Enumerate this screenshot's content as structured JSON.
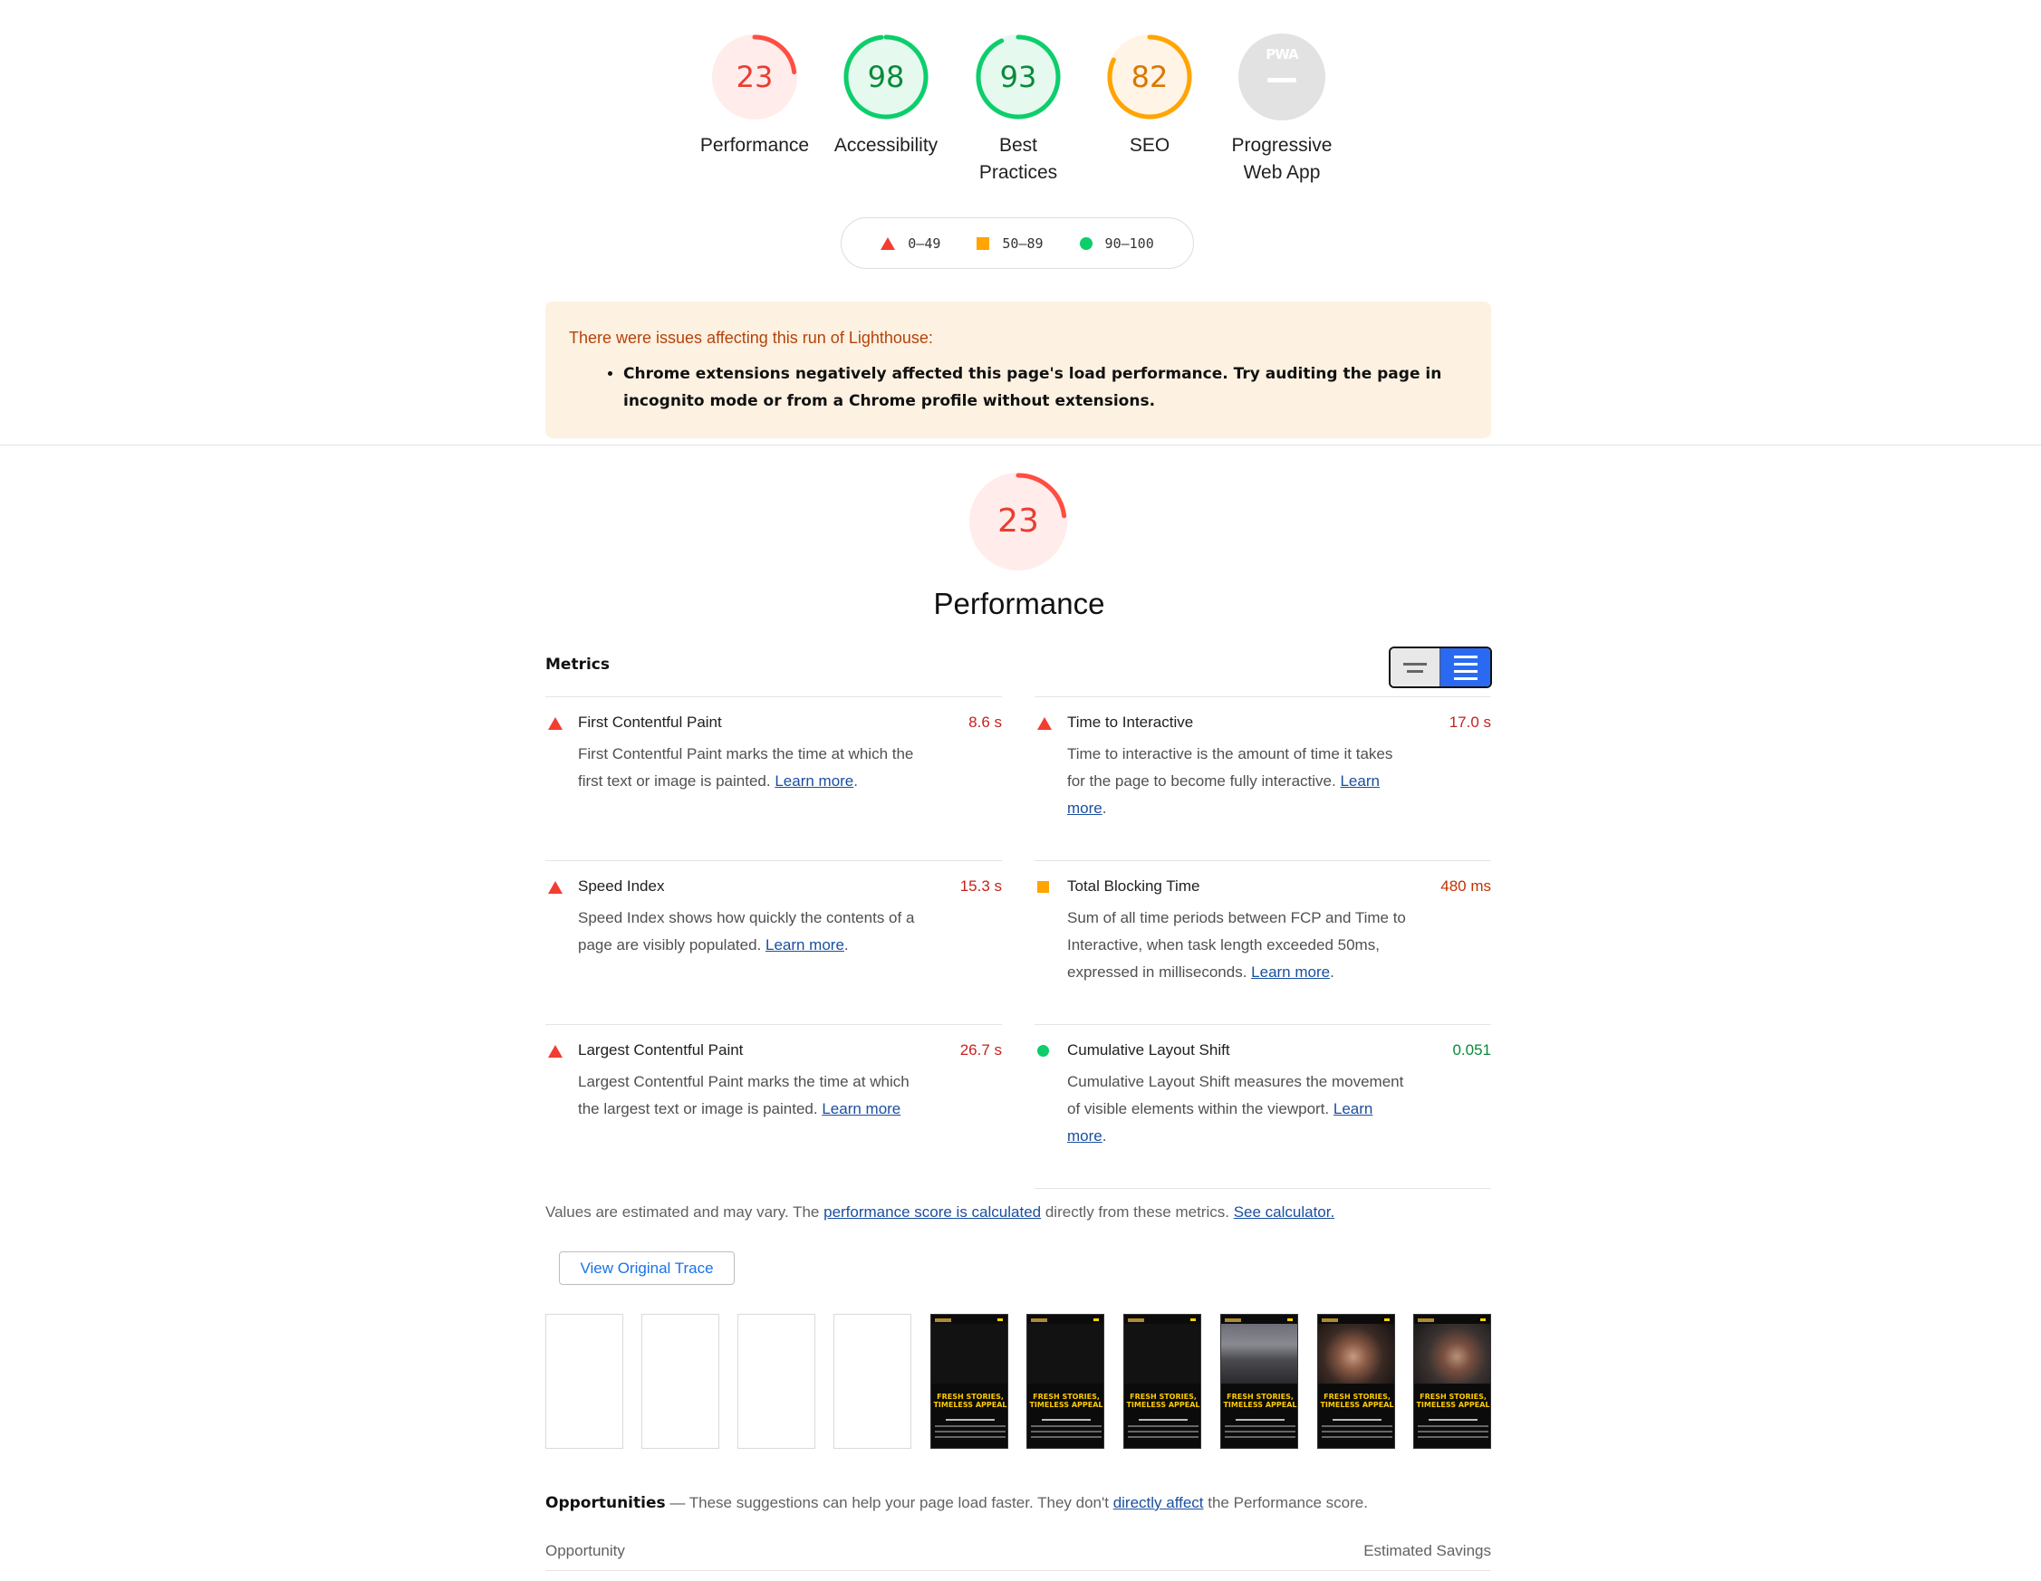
{
  "gauges": [
    {
      "score": "23",
      "label_lines": [
        "Performance"
      ],
      "status": "fail",
      "fraction": 0.23
    },
    {
      "score": "98",
      "label_lines": [
        "Accessibility"
      ],
      "status": "pass",
      "fraction": 0.98
    },
    {
      "score": "93",
      "label_lines": [
        "Best",
        "Practices"
      ],
      "status": "pass",
      "fraction": 0.93
    },
    {
      "score": "82",
      "label_lines": [
        "SEO"
      ],
      "status": "average",
      "fraction": 0.82
    },
    {
      "score": "",
      "label_lines": [
        "Progressive",
        "Web App"
      ],
      "status": "na",
      "badge": "PWA",
      "fraction": 0
    }
  ],
  "legend": {
    "fail": "0–49",
    "average": "50–89",
    "pass": "90–100"
  },
  "warning": {
    "title": "There were issues affecting this run of Lighthouse:",
    "item": "Chrome extensions negatively affected this page's load performance. Try auditing the page in incognito mode or from a Chrome profile without extensions."
  },
  "performance": {
    "score": "23",
    "fraction": 0.23,
    "title": "Performance"
  },
  "metrics_title": "Metrics",
  "metrics": [
    {
      "name": "First Contentful Paint",
      "value": "8.6 s",
      "status": "fail",
      "desc": "First Contentful Paint marks the time at which the first text or image is painted.",
      "link": "Learn more"
    },
    {
      "name": "Time to Interactive",
      "value": "17.0 s",
      "status": "fail",
      "desc": "Time to interactive is the amount of time it takes for the page to become fully interactive.",
      "link": "Learn more"
    },
    {
      "name": "Speed Index",
      "value": "15.3 s",
      "status": "fail",
      "desc": "Speed Index shows how quickly the contents of a page are visibly populated.",
      "link": "Learn more"
    },
    {
      "name": "Total Blocking Time",
      "value": "480 ms",
      "status": "average",
      "desc": "Sum of all time periods between FCP and Time to Interactive, when task length exceeded 50ms, expressed in milliseconds.",
      "link": "Learn more"
    },
    {
      "name": "Largest Contentful Paint",
      "value": "26.7 s",
      "status": "fail",
      "desc": "Largest Contentful Paint marks the time at which the largest text or image is painted.",
      "link": "Learn more"
    },
    {
      "name": "Cumulative Layout Shift",
      "value": "0.051",
      "status": "pass",
      "desc": "Cumulative Layout Shift measures the movement of visible elements within the viewport.",
      "link": "Learn more"
    }
  ],
  "estimate": {
    "prefix": "Values are estimated and may vary. The ",
    "link1": "performance score is calculated",
    "middle": " directly from these metrics. ",
    "link2": "See calculator."
  },
  "trace_button": "View Original Trace",
  "filmstrip": {
    "headline_line1": "FRESH STORIES,",
    "headline_line2": "TIMELESS APPEAL",
    "frames": [
      "blank",
      "blank",
      "blank",
      "blank",
      "dark",
      "dark",
      "dark",
      "photo-street",
      "photo-face",
      "photo-face2"
    ]
  },
  "opportunities": {
    "title": "Opportunities",
    "dash": " — ",
    "text1": "These suggestions can help your page load faster. They don't ",
    "link": "directly affect",
    "text2": " the Performance score.",
    "col_left": "Opportunity",
    "col_right": "Estimated Savings"
  },
  "colors": {
    "fail": "#ff4e42",
    "average": "#ffa400",
    "pass": "#0cce6b",
    "fail_bg": "#ffeceb",
    "pass_bg": "#e6f9ef",
    "avg_bg": "#fff4e5",
    "na": "#e2e2e2"
  }
}
